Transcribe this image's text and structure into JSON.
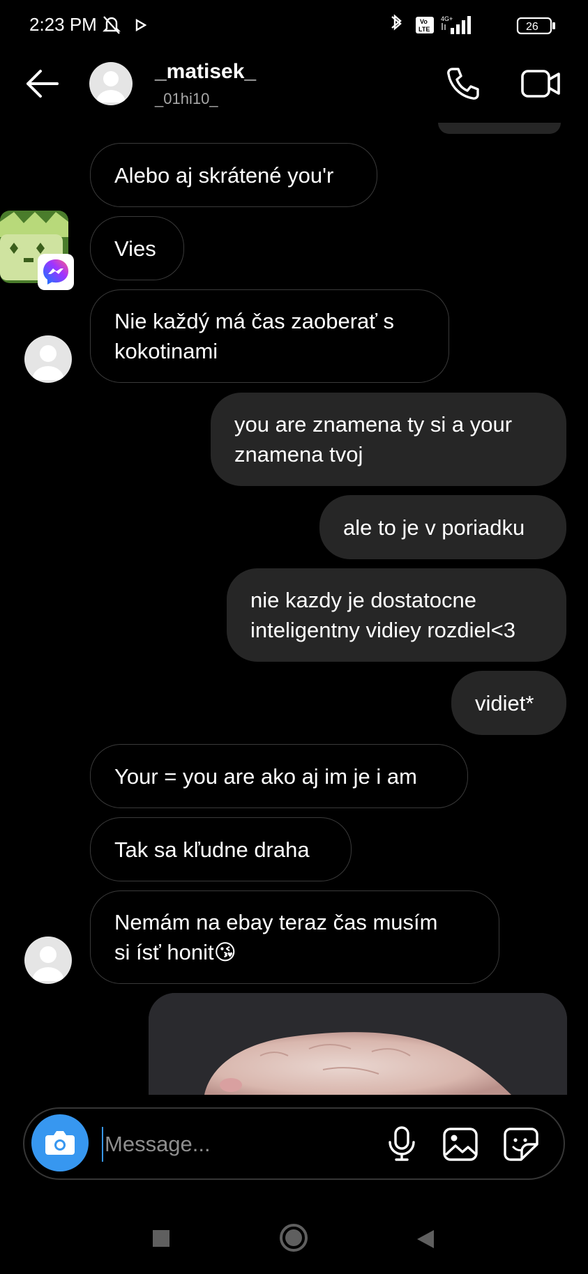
{
  "status_bar": {
    "time": "2:23 PM",
    "volte": "Vo LTE",
    "network": "4G+",
    "battery": "26"
  },
  "header": {
    "username": "_matisek_",
    "subname": "_01hi10_"
  },
  "messages": [
    {
      "dir": "in",
      "text": "Alebo aj skrátené you'r"
    },
    {
      "dir": "in",
      "text": "Vies"
    },
    {
      "dir": "in",
      "text": "Nie každý má čas zaoberať s\nkokotinami"
    },
    {
      "dir": "out",
      "text": "you are znamena ty si a your\nznamena tvoj"
    },
    {
      "dir": "out",
      "text": "ale to je v poriadku"
    },
    {
      "dir": "out",
      "text": "nie kazdy je dostatocne\ninteligentny vidiey rozdiel<3"
    },
    {
      "dir": "out",
      "text": "vidiet*"
    },
    {
      "dir": "in",
      "text": "Your = you are ako aj im je i am"
    },
    {
      "dir": "in",
      "text": "Tak sa kľudne draha"
    },
    {
      "dir": "in",
      "text": "Nemám na ebay teraz čas musím\nsi ísť honit😘"
    }
  ],
  "composer": {
    "placeholder": "Message..."
  },
  "colors": {
    "accent": "#3797f0",
    "outgoing_bubble": "#262626",
    "background": "#000000"
  },
  "icons": [
    "back-arrow-icon",
    "phone-icon",
    "video-camera-icon",
    "camera-icon",
    "microphone-icon",
    "gallery-icon",
    "sticker-icon",
    "messenger-icon"
  ]
}
